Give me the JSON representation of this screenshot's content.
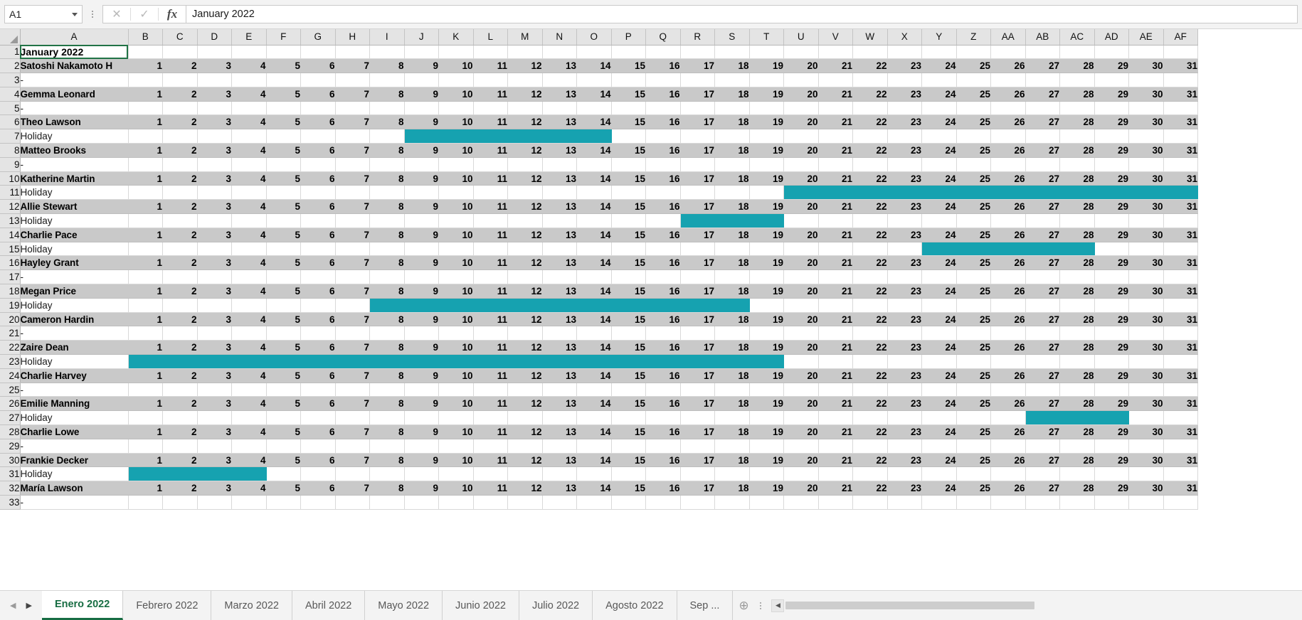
{
  "formula_bar": {
    "name_box_value": "A1",
    "cancel_icon": "close-icon",
    "confirm_icon": "check-icon",
    "function_icon": "fx-icon",
    "formula_value": "January 2022"
  },
  "grid": {
    "columns": [
      "A",
      "B",
      "C",
      "D",
      "E",
      "F",
      "G",
      "H",
      "I",
      "J",
      "K",
      "L",
      "M",
      "N",
      "O",
      "P",
      "Q",
      "R",
      "S",
      "T",
      "U",
      "V",
      "W",
      "X",
      "Y",
      "Z",
      "AA",
      "AB",
      "AC",
      "AD",
      "AE",
      "AF"
    ],
    "days": [
      1,
      2,
      3,
      4,
      5,
      6,
      7,
      8,
      9,
      10,
      11,
      12,
      13,
      14,
      15,
      16,
      17,
      18,
      19,
      20,
      21,
      22,
      23,
      24,
      25,
      26,
      27,
      28,
      29,
      30,
      31
    ],
    "title_cell": "January 2022",
    "holiday_label": "Holiday",
    "empty_label": "-",
    "bar_color": "#16a2b0",
    "person_row_bg": "#c9c9c9",
    "rows": [
      {
        "row": 1,
        "type": "title",
        "label": "January 2022"
      },
      {
        "row": 2,
        "type": "person",
        "label": "Satoshi Nakamoto H"
      },
      {
        "row": 3,
        "type": "holiday",
        "label": "-",
        "bar_start": null,
        "bar_end": null
      },
      {
        "row": 4,
        "type": "person",
        "label": "Gemma Leonard"
      },
      {
        "row": 5,
        "type": "holiday",
        "label": "-",
        "bar_start": null,
        "bar_end": null
      },
      {
        "row": 6,
        "type": "person",
        "label": "Theo Lawson"
      },
      {
        "row": 7,
        "type": "holiday",
        "label": "Holiday",
        "bar_start": 9,
        "bar_end": 14
      },
      {
        "row": 8,
        "type": "person",
        "label": "Matteo Brooks"
      },
      {
        "row": 9,
        "type": "holiday",
        "label": "-",
        "bar_start": null,
        "bar_end": null
      },
      {
        "row": 10,
        "type": "person",
        "label": "Katherine Martin"
      },
      {
        "row": 11,
        "type": "holiday",
        "label": "Holiday",
        "bar_start": 20,
        "bar_end": 31
      },
      {
        "row": 12,
        "type": "person",
        "label": "Allie Stewart"
      },
      {
        "row": 13,
        "type": "holiday",
        "label": "Holiday",
        "bar_start": 17,
        "bar_end": 19
      },
      {
        "row": 14,
        "type": "person",
        "label": "Charlie Pace"
      },
      {
        "row": 15,
        "type": "holiday",
        "label": "Holiday",
        "bar_start": 24,
        "bar_end": 28
      },
      {
        "row": 16,
        "type": "person",
        "label": "Hayley Grant"
      },
      {
        "row": 17,
        "type": "holiday",
        "label": "-",
        "bar_start": null,
        "bar_end": null
      },
      {
        "row": 18,
        "type": "person",
        "label": "Megan Price"
      },
      {
        "row": 19,
        "type": "holiday",
        "label": "Holiday",
        "bar_start": 8,
        "bar_end": 18
      },
      {
        "row": 20,
        "type": "person",
        "label": "Cameron Hardin"
      },
      {
        "row": 21,
        "type": "holiday",
        "label": "-",
        "bar_start": null,
        "bar_end": null
      },
      {
        "row": 22,
        "type": "person",
        "label": "Zaire Dean"
      },
      {
        "row": 23,
        "type": "holiday",
        "label": "Holiday",
        "bar_start": 1,
        "bar_end": 19
      },
      {
        "row": 24,
        "type": "person",
        "label": "Charlie Harvey"
      },
      {
        "row": 25,
        "type": "holiday",
        "label": "-",
        "bar_start": null,
        "bar_end": null
      },
      {
        "row": 26,
        "type": "person",
        "label": "Emilie Manning"
      },
      {
        "row": 27,
        "type": "holiday",
        "label": "Holiday",
        "bar_start": 27,
        "bar_end": 29
      },
      {
        "row": 28,
        "type": "person",
        "label": "Charlie Lowe"
      },
      {
        "row": 29,
        "type": "holiday",
        "label": "-",
        "bar_start": null,
        "bar_end": null
      },
      {
        "row": 30,
        "type": "person",
        "label": "Frankie Decker"
      },
      {
        "row": 31,
        "type": "holiday",
        "label": "Holiday",
        "bar_start": 1,
        "bar_end": 4
      },
      {
        "row": 32,
        "type": "person",
        "label": "María Lawson"
      },
      {
        "row": 33,
        "type": "holiday",
        "label": "-",
        "bar_start": null,
        "bar_end": null
      }
    ]
  },
  "tabbar": {
    "prev_icon": "chevron-left-icon",
    "next_icon": "chevron-right-icon",
    "add_sheet_icon": "plus-circle-icon",
    "menu_icon": "kebab-menu-icon",
    "scroll_left_icon": "chevron-left-icon",
    "tabs": [
      {
        "label": "Enero 2022",
        "active": true
      },
      {
        "label": "Febrero 2022",
        "active": false
      },
      {
        "label": "Marzo 2022",
        "active": false
      },
      {
        "label": "Abril 2022",
        "active": false
      },
      {
        "label": "Mayo 2022",
        "active": false
      },
      {
        "label": "Junio 2022",
        "active": false
      },
      {
        "label": "Julio 2022",
        "active": false
      },
      {
        "label": "Agosto 2022",
        "active": false
      },
      {
        "label": "Sep ...",
        "active": false
      }
    ]
  }
}
